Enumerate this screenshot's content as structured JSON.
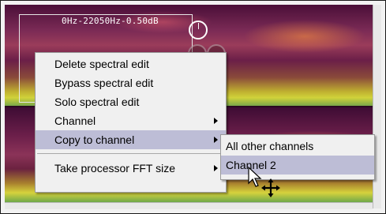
{
  "spectrogram": {
    "frequency_label": "0Hz-22050Hz-0.50dB"
  },
  "context_menu": {
    "items": [
      {
        "label": "Delete spectral edit"
      },
      {
        "label": "Bypass spectral edit"
      },
      {
        "label": "Solo spectral edit"
      },
      {
        "label": "Channel",
        "has_submenu": true
      },
      {
        "label": "Copy to channel",
        "has_submenu": true,
        "highlighted": true
      },
      {
        "label": "Take processor FFT size",
        "has_submenu": true
      }
    ]
  },
  "submenu": {
    "items": [
      {
        "label": "All other channels"
      },
      {
        "label": "Channel 2",
        "highlighted": true
      }
    ]
  },
  "colors": {
    "menu_highlight": "#bdbdd6",
    "menu_background": "#f0f0f0"
  }
}
